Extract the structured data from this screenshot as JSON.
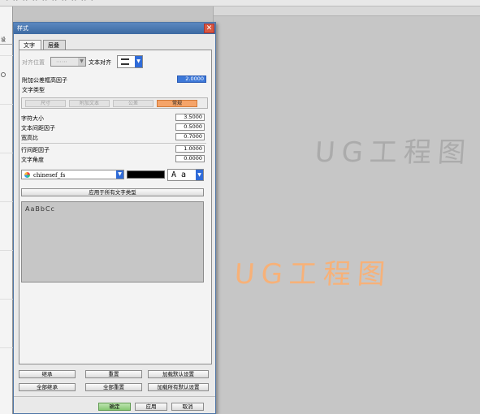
{
  "dialog": {
    "title": "样式",
    "close_symbol": "✕",
    "tabs": [
      "文字",
      "层叠"
    ],
    "text_section": {
      "align_position_label": "对齐位置",
      "align_position_value": "⋯⋯",
      "text_align_label": "文本对齐",
      "tolerance_factor_label": "附加公差框高因子",
      "tolerance_factor_value": "2.0000",
      "text_type_label": "文字类型",
      "text_types": [
        "尺寸",
        "附加文本",
        "公差",
        "常规"
      ],
      "active_text_type": "常规",
      "char_size_label": "字符大小",
      "char_size_value": "3.5000",
      "text_gap_label": "文本间距因子",
      "text_gap_value": "0.5000",
      "aspect_label": "宽高比",
      "aspect_value": "0.7000",
      "line_gap_label": "行间距因子",
      "line_gap_value": "1.0000",
      "angle_label": "文字角度",
      "angle_value": "0.0000",
      "font_value": "chinesef_fs",
      "font_style_value": "A a",
      "apply_all_label": "应用于所有文字类型",
      "preview_text": "AaBbCc"
    },
    "footer": {
      "inherit_label": "继承",
      "reset_label": "重置",
      "load_default_label": "加载默认设置",
      "inherit_all_label": "全部继承",
      "reset_all_label": "全部重置",
      "load_all_default_label": "加载所有默认设置",
      "ok_label": "确定",
      "apply_label": "应用",
      "cancel_label": "取消"
    }
  },
  "canvas": {
    "note_gray": "UG工程图",
    "note_orange": "UG工程图",
    "note_gray_color": "#ababab",
    "note_orange_color": "#f7b178"
  },
  "left_panel": {
    "tab_label": "设"
  },
  "colors": {
    "titlebar": "#4777b0",
    "active_type": "#f5a469",
    "selection": "#3d78d8",
    "ok_button": "#86c873"
  }
}
